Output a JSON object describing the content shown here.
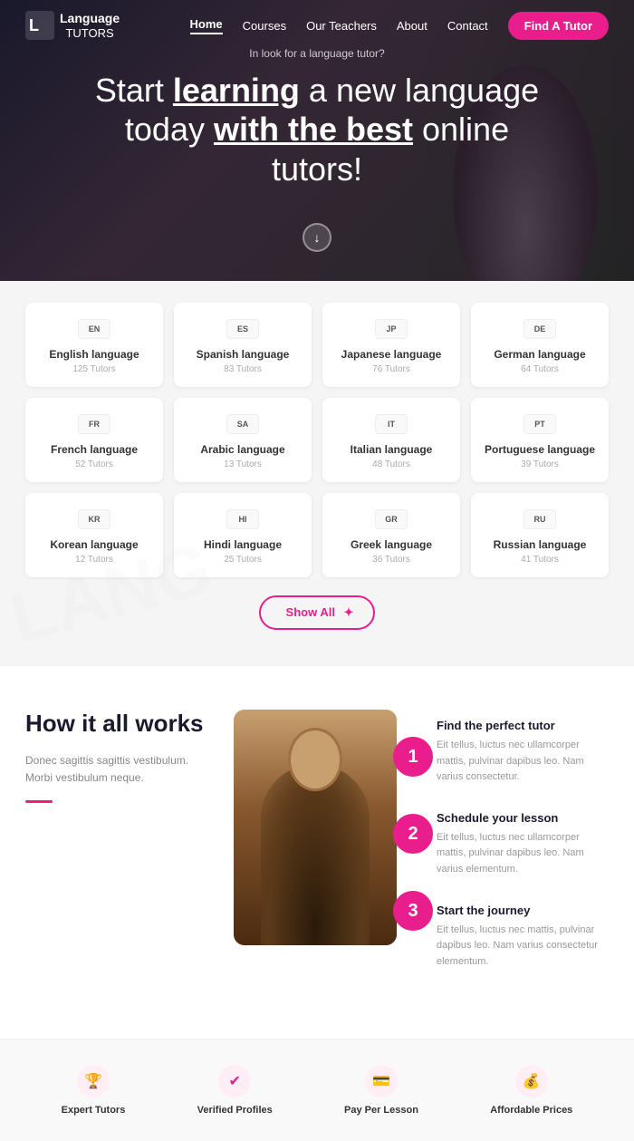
{
  "site": {
    "logo_name": "Language",
    "logo_sub": "TUTORS"
  },
  "navbar": {
    "links": [
      "Home",
      "Courses",
      "Our Teachers",
      "About",
      "Contact"
    ],
    "active": "Home",
    "cta": "Find A Tutor"
  },
  "hero": {
    "tagline": "In look for a language tutor?",
    "title_start": "Start ",
    "title_learning": "learning",
    "title_mid": " a new language today ",
    "title_withbest": "with the best",
    "title_end": " online tutors!"
  },
  "languages": {
    "row1": [
      {
        "code": "EN",
        "name": "English language",
        "tutors": "125 Tutors"
      },
      {
        "code": "ES",
        "name": "Spanish language",
        "tutors": "83 Tutors"
      },
      {
        "code": "JP",
        "name": "Japanese language",
        "tutors": "76 Tutors"
      },
      {
        "code": "DE",
        "name": "German language",
        "tutors": "64 Tutors"
      }
    ],
    "row2": [
      {
        "code": "FR",
        "name": "French language",
        "tutors": "52 Tutors"
      },
      {
        "code": "SA",
        "name": "Arabic language",
        "tutors": "13 Tutors"
      },
      {
        "code": "IT",
        "name": "Italian language",
        "tutors": "48 Tutors"
      },
      {
        "code": "PT",
        "name": "Portuguese language",
        "tutors": "39 Tutors"
      }
    ],
    "row3": [
      {
        "code": "KR",
        "name": "Korean language",
        "tutors": "12 Tutors"
      },
      {
        "code": "HI",
        "name": "Hindi language",
        "tutors": "25 Tutors"
      },
      {
        "code": "GR",
        "name": "Greek language",
        "tutors": "36 Tutors"
      },
      {
        "code": "RU",
        "name": "Russian language",
        "tutors": "41 Tutors"
      }
    ],
    "show_all": "Show All"
  },
  "how": {
    "title": "How it all works",
    "desc": "Donec sagittis sagittis vestibulum. Morbi vestibulum neque.",
    "steps": [
      {
        "num": "1",
        "title": "Find the perfect tutor",
        "desc": "Eit tellus, luctus nec ullamcorper mattis, pulvinar dapibus leo. Nam varius consectetur."
      },
      {
        "num": "2",
        "title": "Schedule your lesson",
        "desc": "Eit tellus, luctus nec ullamcorper mattis, pulvinar dapibus leo. Nam varius elementum."
      },
      {
        "num": "3",
        "title": "Start the journey",
        "desc": "Eit tellus, luctus nec mattis, pulvinar dapibus leo. Nam varius consectetur elementum."
      }
    ]
  },
  "features": [
    {
      "icon": "🏆",
      "label": "Expert Tutors"
    },
    {
      "icon": "✔",
      "label": "Verified Profiles"
    },
    {
      "icon": "💳",
      "label": "Pay Per Lesson"
    },
    {
      "icon": "💰",
      "label": "Affordable Prices"
    }
  ]
}
